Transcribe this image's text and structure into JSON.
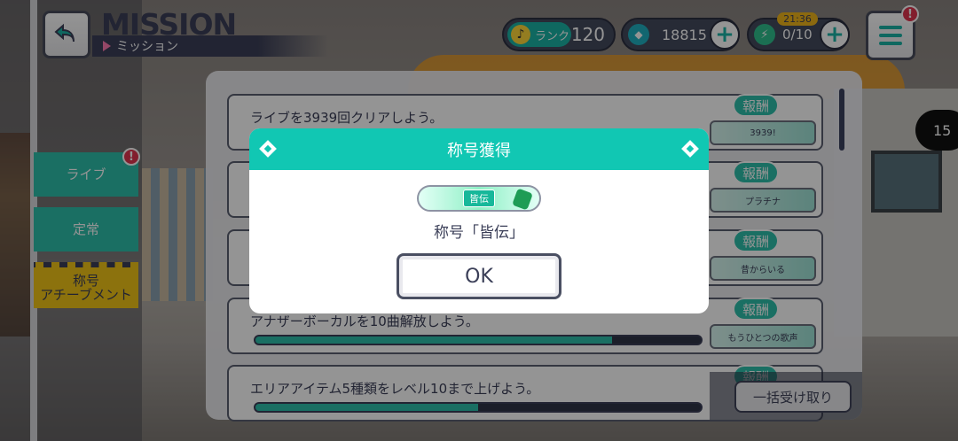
{
  "header": {
    "title": "MISSION",
    "subtitle": "ミッション",
    "rank_label": "ランク",
    "rank_value": "120",
    "gems": "18815",
    "energy": "0/10",
    "timer": "21:36",
    "badge_mark": "!"
  },
  "sidebar": {
    "tabs": [
      {
        "label": "ライブ"
      },
      {
        "label": "定常"
      },
      {
        "label": "称号\nアチーブメント"
      }
    ]
  },
  "missions": [
    {
      "text": "ライブを3939回クリアしよう。",
      "reward_label": "報酬",
      "reward_name": "3939!",
      "progress": null
    },
    {
      "text": "",
      "reward_label": "報酬",
      "reward_name": "プラチナ",
      "progress": null
    },
    {
      "text": "",
      "reward_label": "報酬",
      "reward_name": "昔からいる",
      "progress": null
    },
    {
      "text": "アナザーボーカルを10曲解放しよう。",
      "reward_label": "報酬",
      "reward_name": "もうひとつの歌声",
      "progress": 0.8
    },
    {
      "text": "エリアアイテム5種類をレベル10まで上げよう。",
      "reward_label": "報酬",
      "reward_name": "",
      "progress": 0.5
    }
  ],
  "collect_all": "一括受け取り",
  "page_indicator": "15",
  "modal": {
    "title": "称号獲得",
    "plate_tag": "皆伝",
    "message": "称号「皆伝」",
    "ok": "OK"
  }
}
